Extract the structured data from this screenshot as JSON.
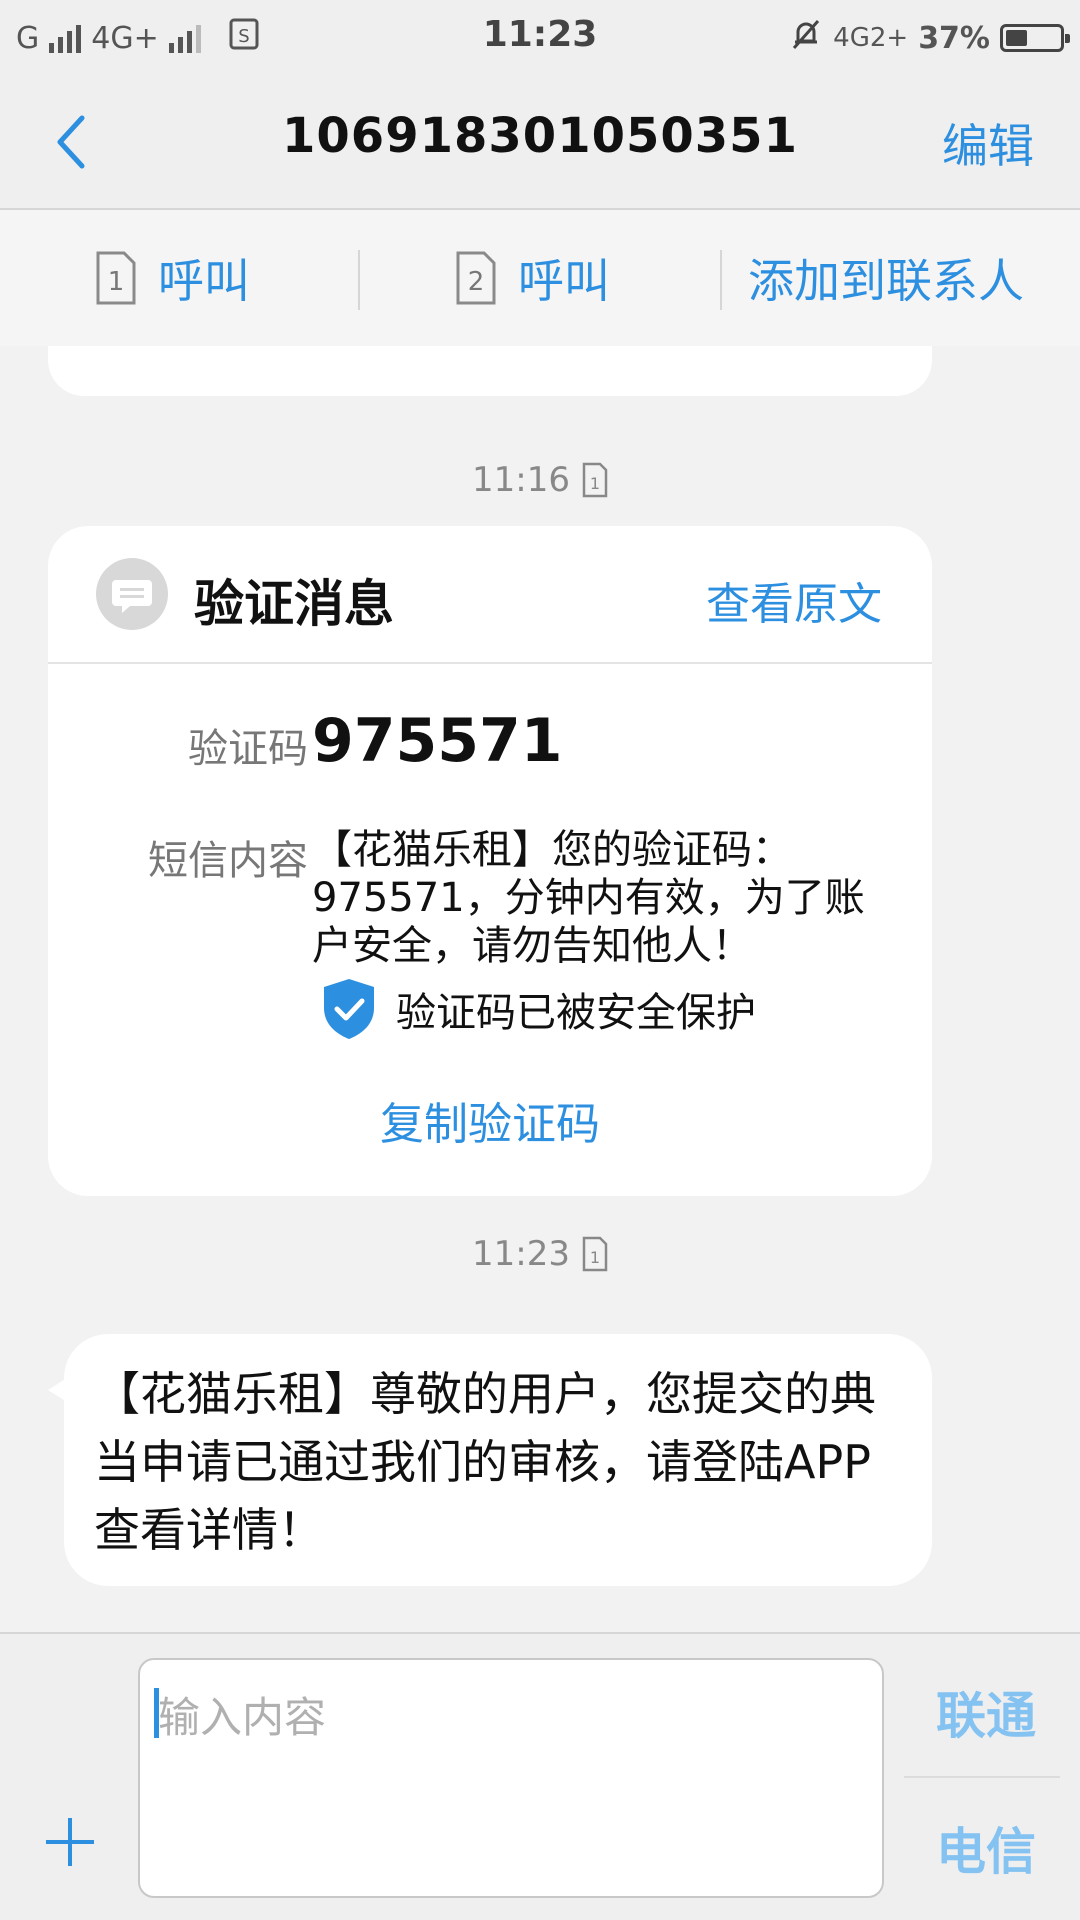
{
  "status_bar": {
    "carrier1": "G",
    "carrier2": "4G+",
    "time": "11:23",
    "network": "4G2+",
    "battery": "37%",
    "battery_level": 0.37
  },
  "header": {
    "title": "106918301050351",
    "edit": "编辑"
  },
  "actions": {
    "call_sim1": "呼叫",
    "call_sim2": "呼叫",
    "sim1_number": "1",
    "sim2_number": "2",
    "add_contact": "添加到联系人"
  },
  "conversation": {
    "timestamp1": "11:16",
    "timestamp2": "11:23",
    "verification_card": {
      "title": "验证消息",
      "view_original": "查看原文",
      "code_label": "验证码",
      "code": "975571",
      "content_label": "短信内容",
      "content": "【花猫乐租】您的验证码：975571，分钟内有效，为了账户安全，请勿告知他人！",
      "protection": "验证码已被安全保护",
      "copy": "复制验证码"
    },
    "message": "【花猫乐租】尊敬的用户，您提交的典当申请已通过我们的审核，请登陆APP查看详情！"
  },
  "composer": {
    "placeholder": "输入内容",
    "send_unicom": "联通",
    "send_telecom": "电信"
  },
  "colors": {
    "accent": "#2d8fe0",
    "send_disabled": "#84c2f2"
  }
}
